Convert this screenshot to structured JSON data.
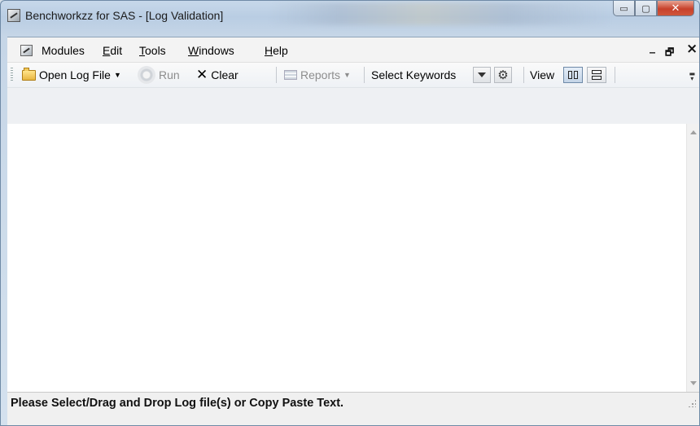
{
  "window": {
    "title": "Benchworkzz for SAS - [Log Validation]",
    "caption_buttons": {
      "minimize_glyph": "▭",
      "maximize_glyph": "▢",
      "close_glyph": "✕"
    }
  },
  "menubar": {
    "items": [
      {
        "label_pre": "",
        "label_u": "",
        "label_post": "Modules"
      },
      {
        "label_pre": "",
        "label_u": "E",
        "label_post": "dit"
      },
      {
        "label_pre": "",
        "label_u": "T",
        "label_post": "ools"
      },
      {
        "label_pre": "",
        "label_u": "W",
        "label_post": "indows"
      },
      {
        "label_pre": "",
        "label_u": "H",
        "label_post": "elp"
      }
    ],
    "mdi_minimize": "_",
    "mdi_restore": "🗗",
    "mdi_close": "×"
  },
  "toolbar": {
    "open_log_file": "Open Log File",
    "run": "Run",
    "clear": "Clear",
    "reports": "Reports",
    "select_keywords": "Select Keywords",
    "view": "View"
  },
  "status": {
    "text": "Please Select/Drag and Drop Log file(s) or Copy Paste Text."
  },
  "colors": {
    "titlebar": "#c7d8ea",
    "close_button": "#c7412b",
    "content_bg": "#ffffff",
    "status_bg": "#f0f0f0"
  }
}
